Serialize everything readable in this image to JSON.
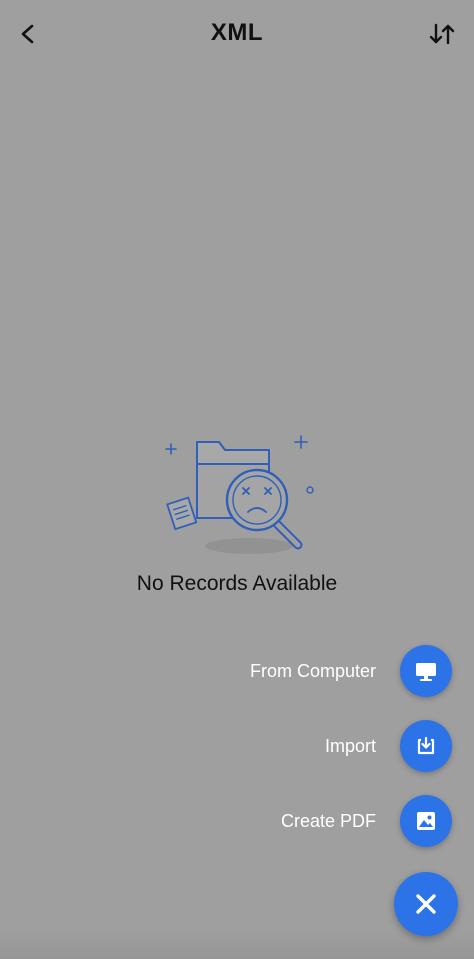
{
  "header": {
    "title": "XML",
    "back_icon": "chevron-left-icon",
    "sort_icon": "sort-arrows-icon"
  },
  "empty_state": {
    "illustration": "folder-search-empty-icon",
    "message": "No Records Available"
  },
  "fab_menu": {
    "items": [
      {
        "label": "From Computer",
        "icon": "monitor-icon"
      },
      {
        "label": "Import",
        "icon": "import-icon"
      },
      {
        "label": "Create PDF",
        "icon": "image-icon"
      }
    ],
    "close_icon": "close-icon"
  },
  "colors": {
    "accent": "#2c73e8",
    "overlay_background": "#9f9f9f",
    "illustration_stroke": "#2f5fb8"
  }
}
